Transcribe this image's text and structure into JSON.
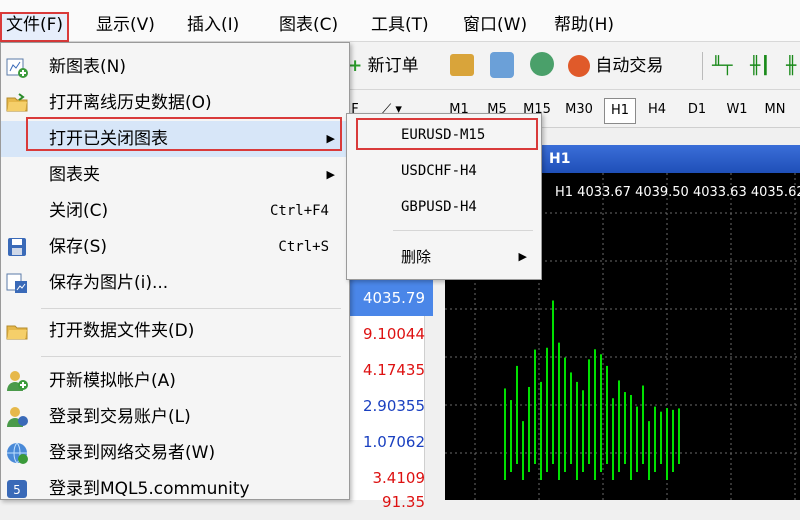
{
  "menubar": [
    "文件(F)",
    "显示(V)",
    "插入(I)",
    "图表(C)",
    "工具(T)",
    "窗口(W)",
    "帮助(H)"
  ],
  "toolbar": {
    "new_order": "新订单",
    "auto_trading": "自动交易"
  },
  "timeframes": [
    "M1",
    "M5",
    "M15",
    "M30",
    "H1",
    "H4",
    "D1",
    "W1",
    "MN"
  ],
  "timeframe_selected": "H1",
  "dropdown": [
    {
      "label": "新图表(N)",
      "shortcut": "",
      "icon": "new-chart-icon"
    },
    {
      "label": "打开离线历史数据(O)",
      "shortcut": "",
      "icon": "open-folder-icon"
    },
    {
      "label": "打开已关闭图表",
      "shortcut": "",
      "icon": ""
    },
    {
      "label": "图表夹",
      "shortcut": "",
      "icon": ""
    },
    {
      "label": "关闭(C)",
      "shortcut": "Ctrl+F4",
      "icon": ""
    },
    {
      "label": "保存(S)",
      "shortcut": "Ctrl+S",
      "icon": "save-icon"
    },
    {
      "label": "保存为图片(i)...",
      "shortcut": "",
      "icon": "save-picture-icon"
    },
    {
      "label": "打开数据文件夹(D)",
      "shortcut": "",
      "icon": "open-folder-icon"
    },
    {
      "label": "开新模拟帐户(A)",
      "shortcut": "",
      "icon": "demo-account-icon"
    },
    {
      "label": "登录到交易账户(L)",
      "shortcut": "",
      "icon": "login-icon"
    },
    {
      "label": "登录到网络交易者(W)",
      "shortcut": "",
      "icon": "web-trader-icon"
    },
    {
      "label": "登录到MQL5.community",
      "shortcut": "",
      "icon": "mql5-icon"
    }
  ],
  "submenu": [
    "EURUSD-M15",
    "USDCHF-H4",
    "GBPUSD-H4",
    "删除"
  ],
  "chart": {
    "title": "H1",
    "info": "H1  4033.67 4039.50 4033.63 4035.62"
  },
  "market_watch": [
    "4035.79",
    "9.10044",
    "4.17435",
    "2.90355",
    "1.07062",
    "3.4109",
    "91.35"
  ],
  "colors": {
    "highlight_border": "#d93a3a",
    "chart_title": "#2a5cc8",
    "candles": "#00e000"
  },
  "chart_data": {
    "type": "bar",
    "values": [
      0.28,
      0.22,
      0.3,
      0.18,
      0.26,
      0.35,
      0.3,
      0.38,
      0.5,
      0.42,
      0.35,
      0.28,
      0.3,
      0.25,
      0.32,
      0.4,
      0.36,
      0.3,
      0.25,
      0.28,
      0.22,
      0.26,
      0.2,
      0.24,
      0.18,
      0.2,
      0.16,
      0.22,
      0.19,
      0.17
    ]
  }
}
